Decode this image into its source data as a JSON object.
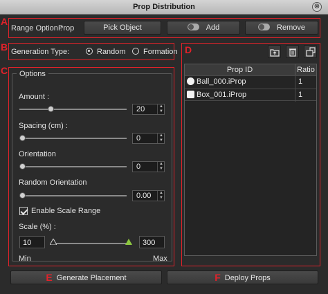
{
  "window": {
    "title": "Prop Distribution",
    "close_symbol": "⊗"
  },
  "section_labels": {
    "a": "A",
    "b": "B",
    "c": "C",
    "d": "D",
    "e": "E",
    "f": "F"
  },
  "range": {
    "label": "Range Option :",
    "value": "Prop",
    "pick_object": "Pick Object",
    "add": "Add",
    "remove": "Remove"
  },
  "generation": {
    "label": "Generation Type:",
    "options": [
      {
        "label": "Random",
        "selected": true
      },
      {
        "label": "Formation",
        "selected": false
      }
    ]
  },
  "options": {
    "group_title": "Options",
    "amount": {
      "label": "Amount :",
      "value": "20",
      "fraction": 0.28
    },
    "spacing": {
      "label": "Spacing (cm) :",
      "value": "0",
      "fraction": 0.0
    },
    "orientation": {
      "label": "Orientation",
      "value": "0",
      "fraction": 0.0
    },
    "random_orientation": {
      "label": "Random Orientation",
      "value": "0.00",
      "fraction": 0.0
    },
    "enable_scale": {
      "label": "Enable Scale Range",
      "checked": true
    },
    "scale": {
      "label": "Scale (%) :",
      "min_value": "10",
      "max_value": "300",
      "min_label": "Min",
      "max_label": "Max"
    }
  },
  "props": {
    "headers": [
      "Prop ID",
      "Ratio"
    ],
    "rows": [
      {
        "id": "Ball_000.iProp",
        "ratio": "1",
        "icon": "sphere-icon"
      },
      {
        "id": "Box_001.iProp",
        "ratio": "1",
        "icon": "cube-icon"
      }
    ]
  },
  "actions": {
    "generate": "Generate Placement",
    "deploy": "Deploy Props"
  },
  "colors": {
    "annotation_red": "#e0222a",
    "scale_max_marker": "#8cc63f"
  }
}
